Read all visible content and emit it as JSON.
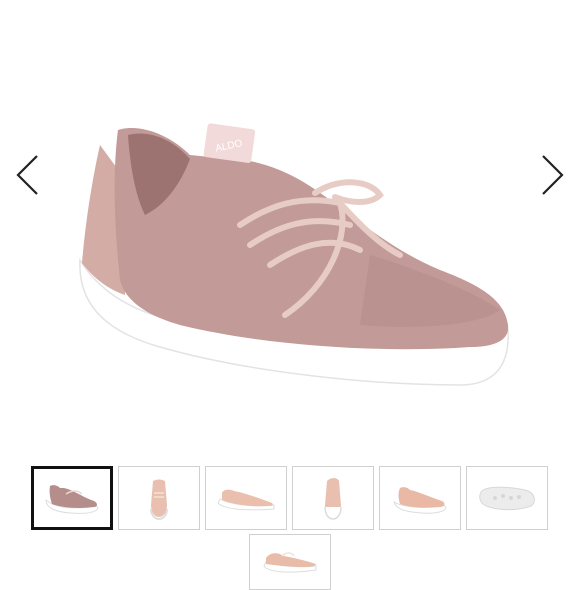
{
  "viewer": {
    "brand_tag": "ALDO",
    "colors": {
      "knit": "#c29a97",
      "knit_dark": "#a57d7a",
      "heel": "#d3aca5",
      "sole": "#ffffff",
      "lace": "#e7ccc6",
      "tag": "#f3dada",
      "arrow": "#222222"
    },
    "prev_icon": "chevron-left-icon",
    "next_icon": "chevron-right-icon"
  },
  "thumbnails": [
    {
      "view": "side",
      "color": "#b58e8b",
      "active": true
    },
    {
      "view": "front",
      "color": "#e9c0b0",
      "active": false
    },
    {
      "view": "side-flat",
      "color": "#eabfad",
      "active": false
    },
    {
      "view": "back",
      "color": "#e9c0b0",
      "active": false
    },
    {
      "view": "side",
      "color": "#e9b9a6",
      "active": false
    },
    {
      "view": "sole",
      "color": "#ececec",
      "active": false
    },
    {
      "view": "top",
      "color": "#e8bca9",
      "active": false
    }
  ]
}
